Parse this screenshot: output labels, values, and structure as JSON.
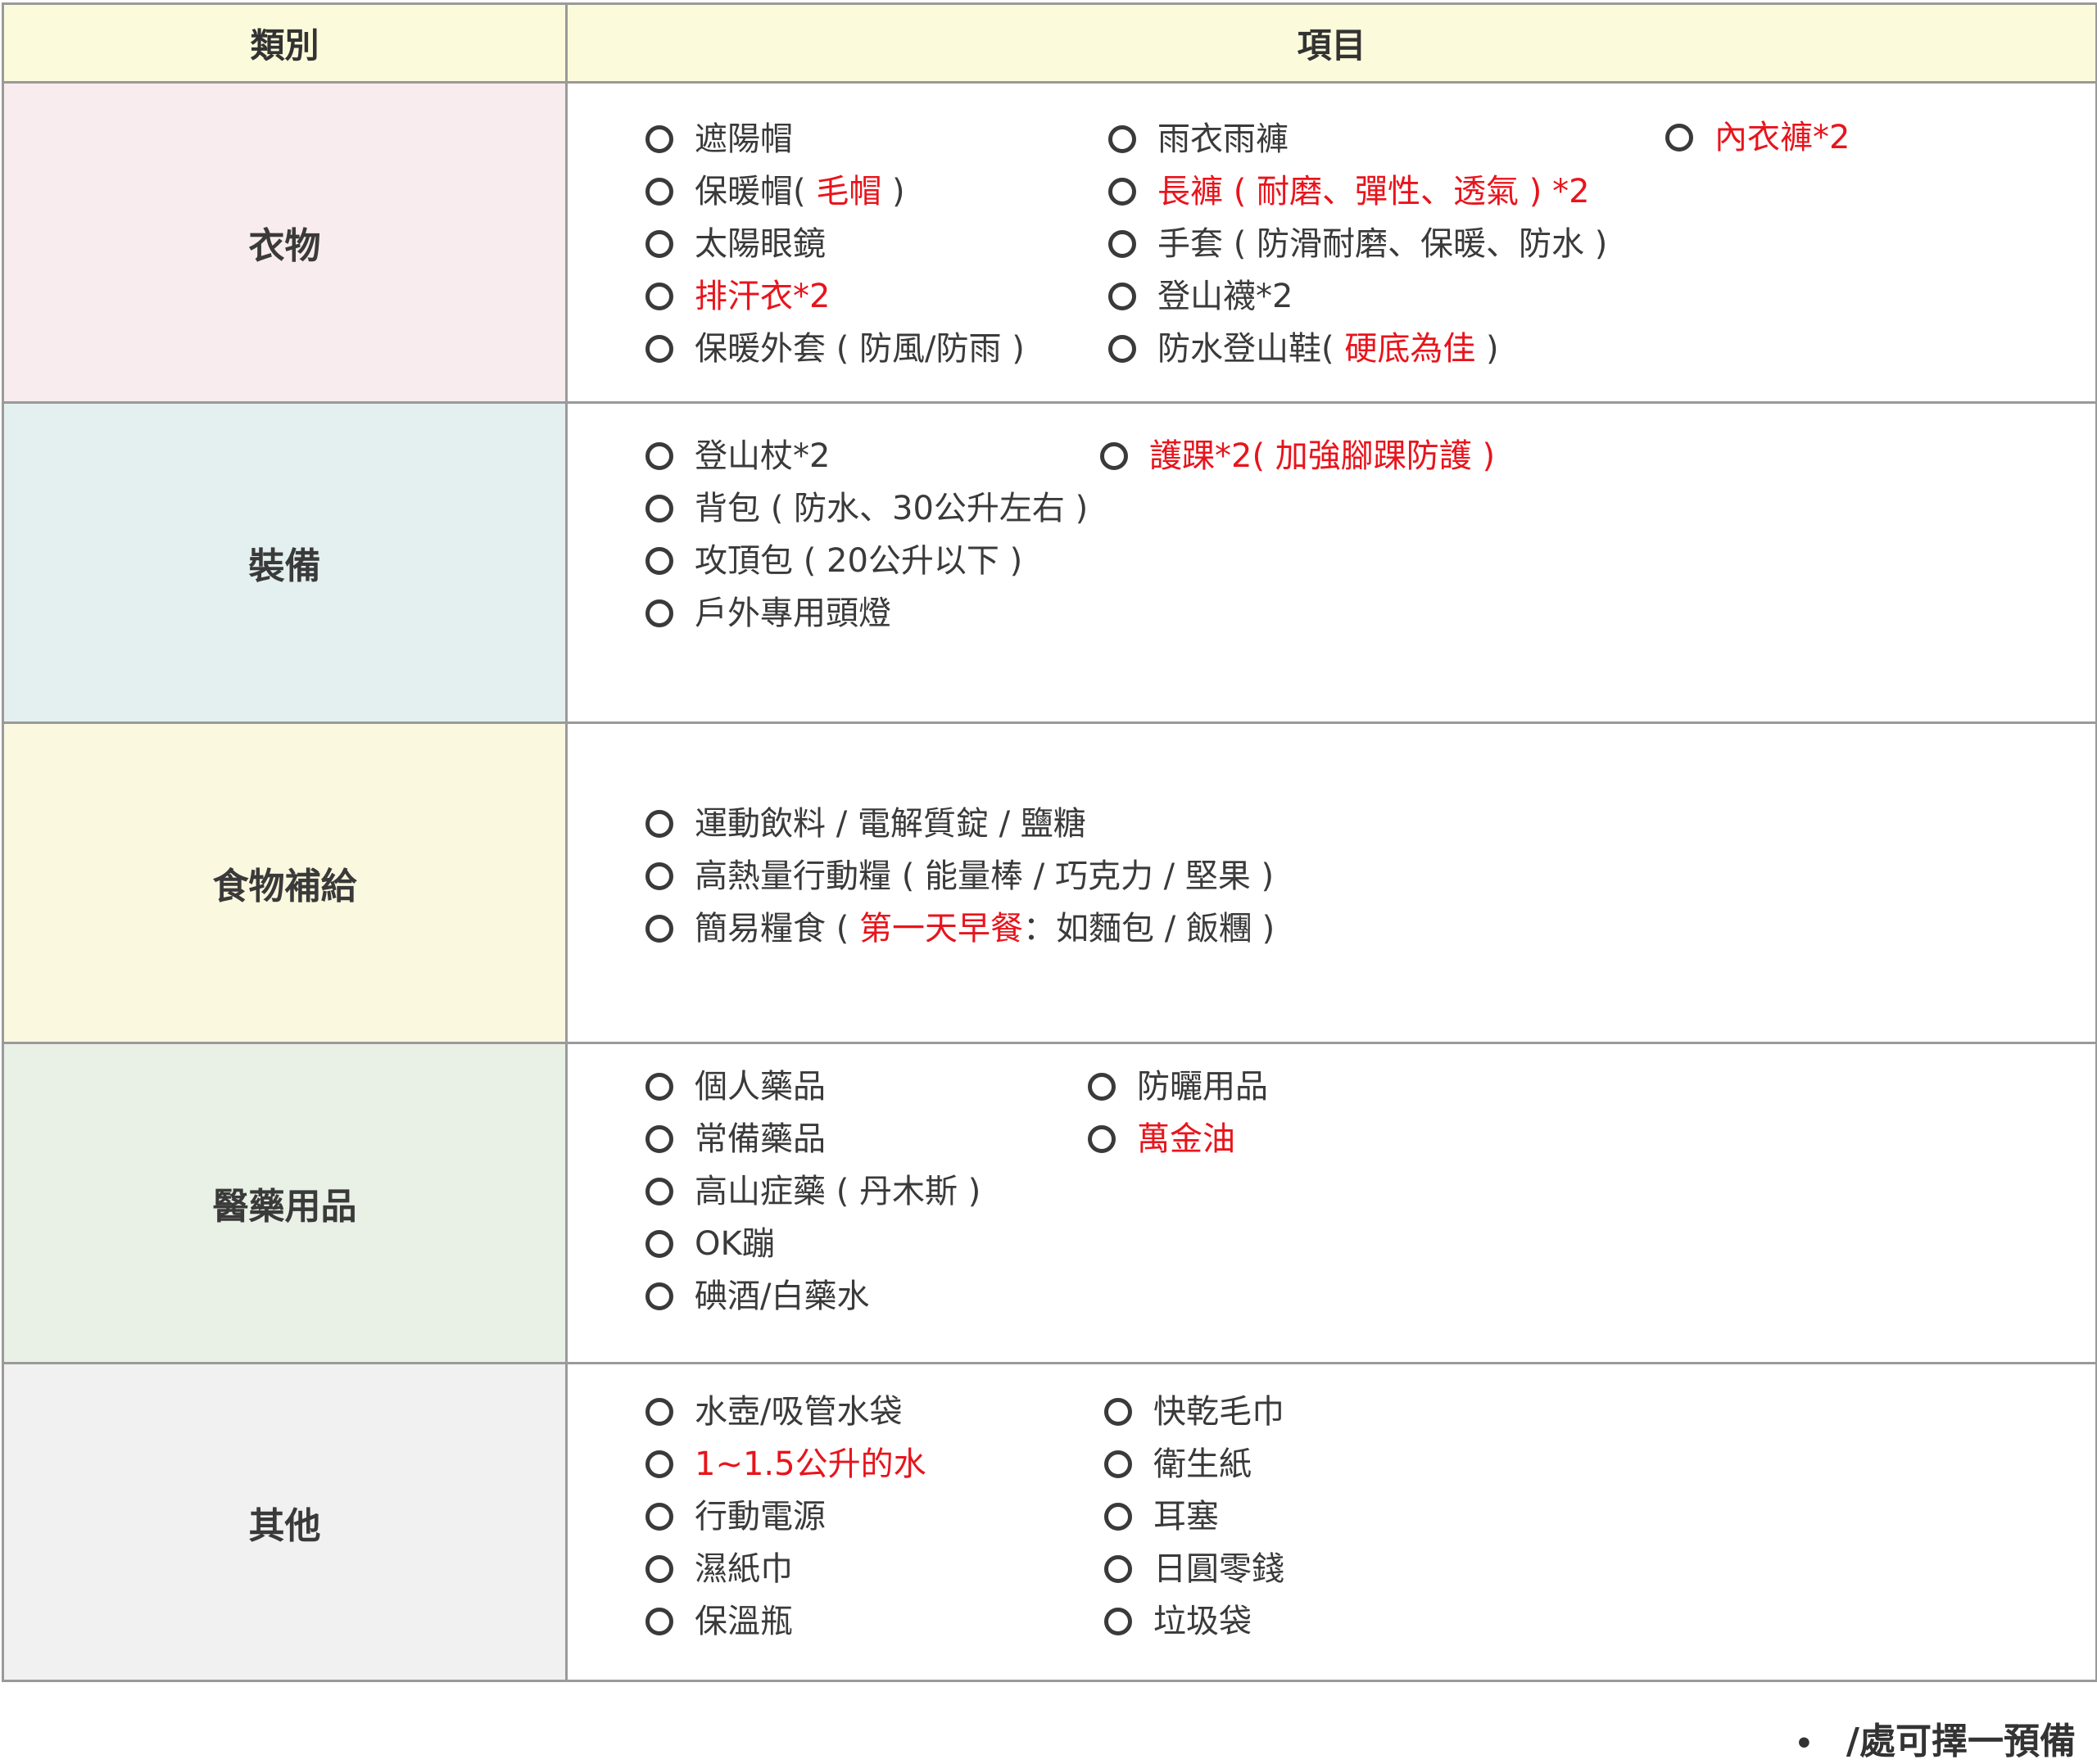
{
  "header": {
    "category": "類別",
    "items": "項目"
  },
  "rows": [
    {
      "category": "衣物",
      "bg": "#f8ecee",
      "columns": [
        [
          [
            {
              "t": "遮陽帽"
            }
          ],
          [
            {
              "t": "保暖帽( "
            },
            {
              "t": "毛帽",
              "r": true
            },
            {
              "t": " )"
            }
          ],
          [
            {
              "t": "太陽眼鏡"
            }
          ],
          [
            {
              "t": "排汗衣*2",
              "r": true
            }
          ],
          [
            {
              "t": "保暖外套 ( 防風/防雨 )"
            }
          ]
        ],
        [
          [
            {
              "t": "雨衣雨褲"
            }
          ],
          [
            {
              "t": "長褲 ( 耐磨、彈性、透氣 ) *2",
              "r": true
            }
          ],
          [
            {
              "t": "手套 ( 防滑耐磨、保暖、防水 )"
            }
          ],
          [
            {
              "t": "登山襪*2"
            }
          ],
          [
            {
              "t": "防水登山鞋( "
            },
            {
              "t": "硬底為佳",
              "r": true
            },
            {
              "t": " )"
            }
          ]
        ],
        [
          [
            {
              "t": "內衣褲*2",
              "r": true
            }
          ]
        ]
      ]
    },
    {
      "category": "裝備",
      "bg": "#e4f0ef",
      "columns": [
        [
          [
            {
              "t": "登山杖*2"
            }
          ],
          [
            {
              "t": "背包 ( 防水、30公升左右 )"
            }
          ],
          [
            {
              "t": "攻頂包 ( 20公升以下 )"
            }
          ],
          [
            {
              "t": "戶外專用頭燈"
            }
          ]
        ],
        [
          [
            {
              "t": "護踝*2( 加強腳踝防護 )",
              "r": true
            }
          ]
        ]
      ]
    },
    {
      "category": "食物補給",
      "bg": "#fbf8e0",
      "columns": [
        [
          [
            {
              "t": " 運動飲料 / 電解質錠 / 鹽糖"
            }
          ],
          [
            {
              "t": "高熱量行動糧 ( 能量棒 / 巧克力 / 堅果 )"
            }
          ],
          [
            {
              "t": "簡易糧食 ( "
            },
            {
              "t": "第一天早餐",
              "r": true
            },
            {
              "t": "：如麵包 / 飯糰 )"
            }
          ]
        ]
      ]
    },
    {
      "category": "醫藥用品",
      "bg": "#e9f0e5",
      "columns": [
        [
          [
            {
              "t": "個人藥品"
            }
          ],
          [
            {
              "t": "常備藥品"
            }
          ],
          [
            {
              "t": "高山症藥 ( 丹木斯 )"
            }
          ],
          [
            {
              "t": "OK蹦"
            }
          ],
          [
            {
              "t": "碘酒/白藥水"
            }
          ]
        ],
        [
          [
            {
              "t": "防曬用品"
            }
          ],
          [
            {
              "t": "萬金油",
              "r": true
            }
          ]
        ]
      ]
    },
    {
      "category": "其他",
      "bg": "#f1f1f1",
      "columns": [
        [
          [
            {
              "t": "水壺/吸管水袋"
            }
          ],
          [
            {
              "t": "1~1.5公升的水",
              "r": true
            }
          ],
          [
            {
              "t": "行動電源"
            }
          ],
          [
            {
              "t": "濕紙巾"
            }
          ],
          [
            {
              "t": "保溫瓶"
            }
          ]
        ],
        [
          [
            {
              "t": "快乾毛巾"
            }
          ],
          [
            {
              "t": "衛生紙"
            }
          ],
          [
            {
              "t": "耳塞"
            }
          ],
          [
            {
              "t": "日圓零錢"
            }
          ],
          [
            {
              "t": " 垃圾袋"
            }
          ]
        ]
      ]
    }
  ],
  "footnote": {
    "bullet": "•",
    "text": "/處可擇一預備"
  },
  "colors": {
    "red": "#e8141c",
    "header_bg": "#fbfbdc",
    "border": "#9a9a9a"
  }
}
